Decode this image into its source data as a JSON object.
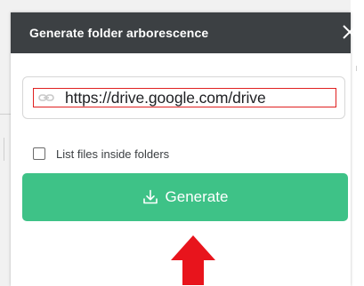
{
  "dialog": {
    "title": "Generate folder arborescence"
  },
  "url_input": {
    "value": "https://drive.google.com/drive"
  },
  "options": {
    "list_files_label": "List files inside folders",
    "list_files_checked": false
  },
  "generate_button": {
    "label": "Generate"
  },
  "colors": {
    "header_bg": "#3c4043",
    "button_green": "#3ec287",
    "highlight_red": "#e02020",
    "arrow_red": "#e8141c"
  },
  "icons": {
    "close": "close-icon",
    "link": "link-icon",
    "download": "download-icon",
    "annotation_arrow": "up-arrow-icon"
  }
}
